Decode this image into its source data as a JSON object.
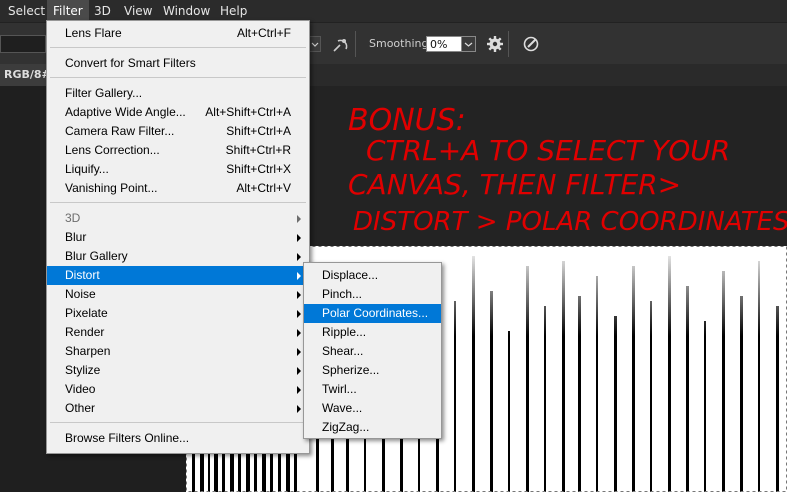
{
  "menubar": {
    "items": [
      "Select",
      "Filter",
      "3D",
      "View",
      "Window",
      "Help"
    ]
  },
  "options": {
    "smoothing_label": "Smoothing:",
    "smoothing_value": "0%"
  },
  "doc_tab": {
    "label": "RGB/8#)"
  },
  "annotation": {
    "lines": [
      "BONUS:",
      "CTRL+A  TO SELECT YOUR",
      "CANVAS, THEN FILTER>",
      "DISTORT > POLAR COORDINATES"
    ],
    "color": "#e00000"
  },
  "filter_menu": {
    "top": [
      {
        "label": "Lens Flare",
        "shortcut": "Alt+Ctrl+F"
      }
    ],
    "smart": [
      {
        "label": "Convert for Smart Filters"
      }
    ],
    "group1": [
      {
        "label": "Filter Gallery...",
        "shortcut": ""
      },
      {
        "label": "Adaptive Wide Angle...",
        "shortcut": "Alt+Shift+Ctrl+A"
      },
      {
        "label": "Camera Raw Filter...",
        "shortcut": "Shift+Ctrl+A"
      },
      {
        "label": "Lens Correction...",
        "shortcut": "Shift+Ctrl+R"
      },
      {
        "label": "Liquify...",
        "shortcut": "Shift+Ctrl+X"
      },
      {
        "label": "Vanishing Point...",
        "shortcut": "Alt+Ctrl+V"
      }
    ],
    "submenus": [
      "3D",
      "Blur",
      "Blur Gallery",
      "Distort",
      "Noise",
      "Pixelate",
      "Render",
      "Sharpen",
      "Stylize",
      "Video",
      "Other"
    ],
    "browse": "Browse Filters Online..."
  },
  "distort_menu": {
    "items": [
      "Displace...",
      "Pinch...",
      "Polar Coordinates...",
      "Ripple...",
      "Shear...",
      "Spherize...",
      "Twirl...",
      "Wave...",
      "ZigZag..."
    ]
  }
}
